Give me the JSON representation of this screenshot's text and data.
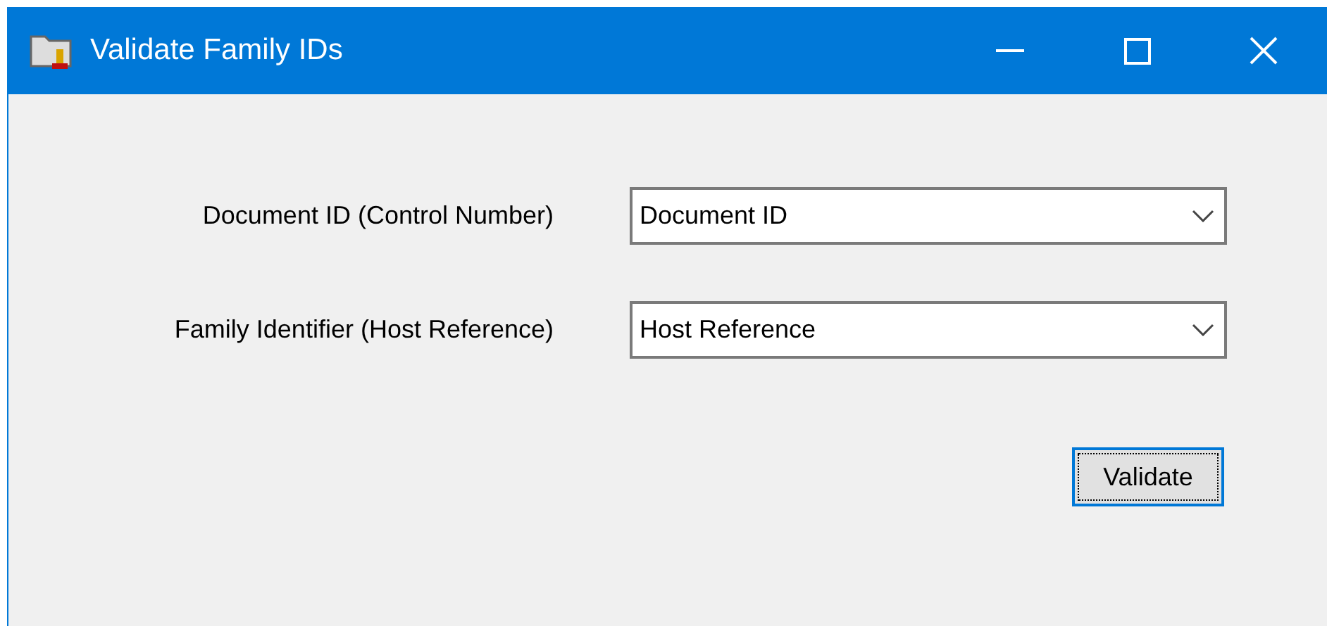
{
  "window": {
    "title": "Validate Family IDs"
  },
  "fields": [
    {
      "label": "Document ID (Control Number)",
      "value": "Document ID"
    },
    {
      "label": "Family Identifier (Host Reference)",
      "value": "Host Reference"
    }
  ],
  "buttons": [
    "Validate"
  ]
}
